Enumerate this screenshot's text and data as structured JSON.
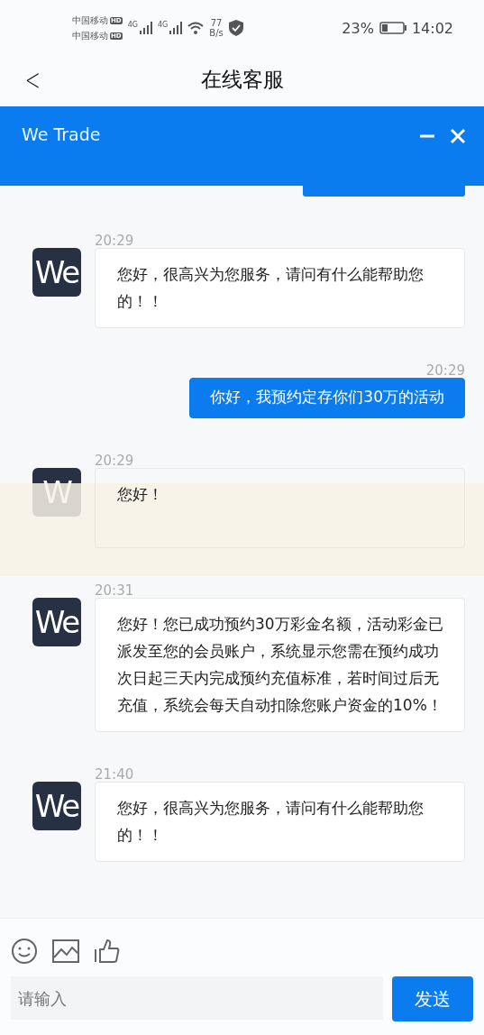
{
  "status_bar": {
    "carrier_1": "中国移动",
    "carrier_2": "中国移动",
    "hd_1": "HD",
    "hd_2": "HD",
    "network_1": "4G",
    "network_2": "4G",
    "speed_value": "77",
    "speed_unit": "B/s",
    "battery_percent": "23%",
    "time": "14:02"
  },
  "nav_bar": {
    "title": "在线客服",
    "back": "<"
  },
  "chat_header": {
    "title": "We Trade"
  },
  "messages": [
    {
      "kind": "agent",
      "time": "20:29",
      "avatar": "We",
      "text": "您好，很高兴为您服务，请问有什么能帮助您的！！",
      "obscured": false
    },
    {
      "kind": "user",
      "time": "20:29",
      "text": "你好，我预约定存你们30万的活动",
      "obscured": false
    },
    {
      "kind": "agent",
      "time": "20:29",
      "avatar": "W",
      "text": "您好！",
      "obscured": true
    },
    {
      "kind": "agent",
      "time": "20:31",
      "avatar": "We",
      "text": "您好！您已成功预约30万彩金名额，活动彩金已派发至您的会员账户，系统显示您需在预约成功次日起三天内完成预约充值标准，若时间过后无充值，系统会每天自动扣除您账户资金的10%！",
      "obscured": false
    },
    {
      "kind": "agent",
      "time": "21:40",
      "avatar": "We",
      "text": "您好，很高兴为您服务，请问有什么能帮助您的！！",
      "obscured": false
    }
  ],
  "composer": {
    "placeholder": "请输入",
    "send": "发送"
  }
}
